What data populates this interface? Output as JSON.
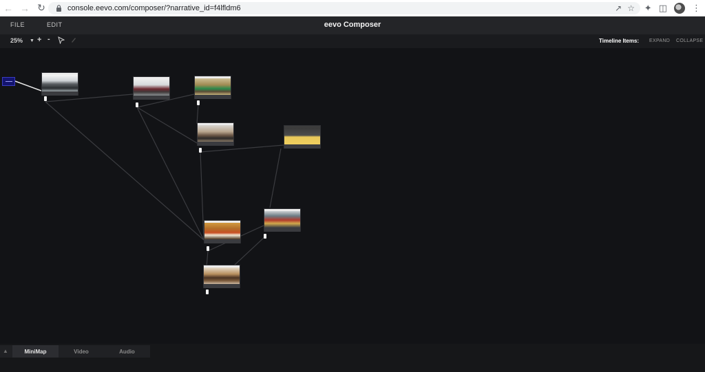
{
  "browser": {
    "url": "console.eevo.com/composer/?narrative_id=f4lfldm6"
  },
  "app": {
    "title": "eevo Composer",
    "menu": [
      {
        "label": "FILE"
      },
      {
        "label": "EDIT"
      }
    ]
  },
  "toolbar": {
    "zoom": "25%",
    "zoom_in": "+",
    "zoom_out": "-",
    "timeline_label": "Timeline Items:",
    "expand_label": "EXPAND",
    "collapse_label": "COLLAPSE"
  },
  "bottom_tabs": [
    {
      "label": "MiniMap",
      "active": true
    },
    {
      "label": "Video",
      "active": false
    },
    {
      "label": "Audio",
      "active": false
    }
  ],
  "colors": {
    "canvas_bg": "#121316",
    "header_bg": "#242528",
    "start_node": "#13146e"
  }
}
